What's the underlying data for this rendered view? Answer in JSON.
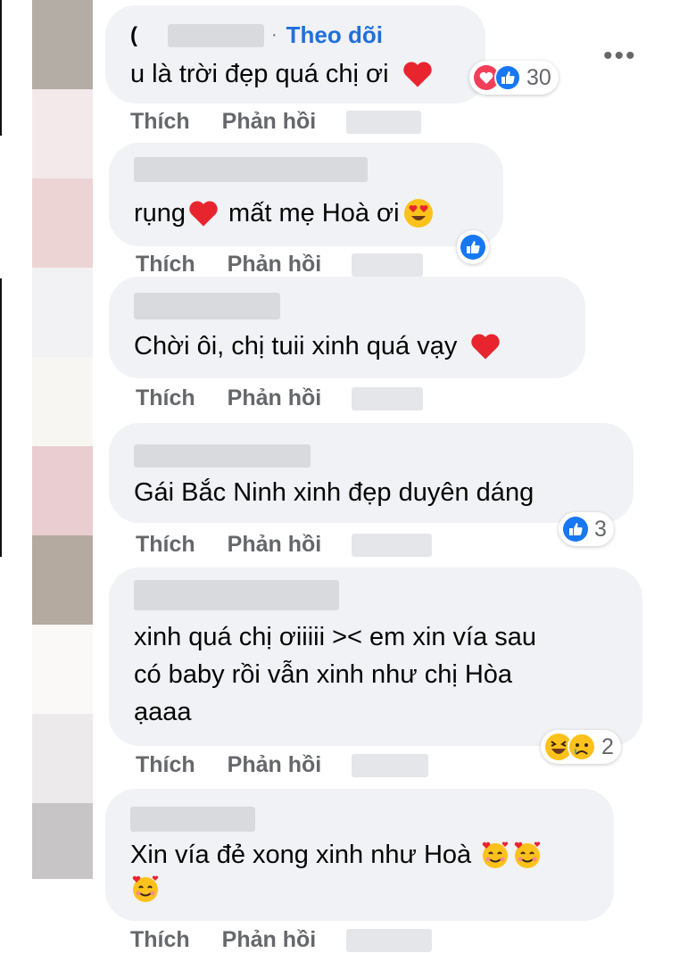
{
  "comments": [
    {
      "follow_label": "Theo dõi",
      "text": "u là trời đẹp quá chị ơi",
      "reaction_count": "30",
      "like_label": "Thích",
      "reply_label": "Phản hồi"
    },
    {
      "text_before": "rụng",
      "text_after": "mất mẹ Hoà ơi",
      "like_label": "Thích",
      "reply_label": "Phản hồi"
    },
    {
      "text": "Chời ôi, chị tuii xinh quá vạy",
      "like_label": "Thích",
      "reply_label": "Phản hồi"
    },
    {
      "text": "Gái Bắc Ninh xinh đẹp duyên dáng",
      "reaction_count": "3",
      "like_label": "Thích",
      "reply_label": "Phản hồi"
    },
    {
      "lines": [
        "xinh quá chị ơiiiii >< em xin vía sau",
        "có baby rồi vẫn xinh như chị Hòa",
        "ạaaa"
      ],
      "reaction_count": "2",
      "like_label": "Thích",
      "reply_label": "Phản hồi"
    },
    {
      "line1": "Xin vía đẻ xong xinh như Hoà",
      "like_label": "Thích",
      "reply_label": "Phản hồi"
    }
  ],
  "more_options": "•••",
  "colors": {
    "bubble": "#f0f2f5",
    "link": "#216fdb",
    "meta": "#65676b",
    "like_blue": "#1877f2",
    "heart_red": "#f33e58"
  },
  "icons": [
    "heart-icon",
    "like-icon",
    "heart-eyes-emoji",
    "laughing-emoji",
    "crying-emoji",
    "smiling-hearts-emoji"
  ]
}
